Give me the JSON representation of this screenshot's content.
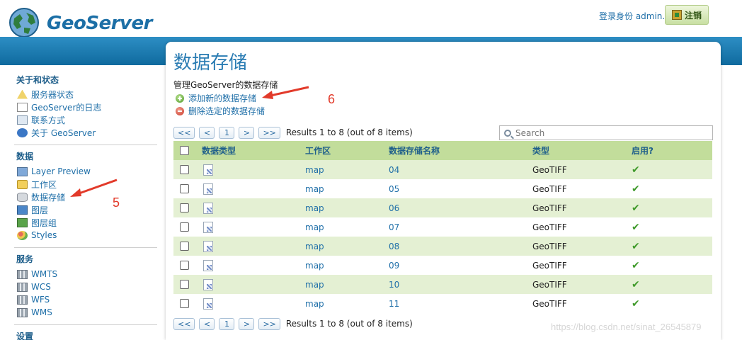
{
  "header": {
    "logo_text": "GeoServer",
    "login_info": "登录身份 admin.",
    "logout_label": "注销"
  },
  "sidebar": {
    "sections": [
      {
        "title": "关于和状态",
        "items": [
          {
            "label": "服务器状态",
            "icon": "warning-icon"
          },
          {
            "label": "GeoServer的日志",
            "icon": "document-icon"
          },
          {
            "label": "联系方式",
            "icon": "contact-card-icon"
          },
          {
            "label": "关于 GeoServer",
            "icon": "info-icon"
          }
        ]
      },
      {
        "title": "数据",
        "items": [
          {
            "label": "Layer Preview",
            "icon": "map-icon"
          },
          {
            "label": "工作区",
            "icon": "folder-icon"
          },
          {
            "label": "数据存储",
            "icon": "database-icon"
          },
          {
            "label": "图层",
            "icon": "layer-icon"
          },
          {
            "label": "图层组",
            "icon": "layer-group-icon"
          },
          {
            "label": "Styles",
            "icon": "styles-icon"
          }
        ]
      },
      {
        "title": "服务",
        "items": [
          {
            "label": "WMTS",
            "icon": "service-icon"
          },
          {
            "label": "WCS",
            "icon": "service-icon"
          },
          {
            "label": "WFS",
            "icon": "service-icon"
          },
          {
            "label": "WMS",
            "icon": "service-icon"
          }
        ]
      },
      {
        "title": "设置",
        "items": []
      }
    ]
  },
  "main": {
    "title": "数据存储",
    "description": "管理GeoServer的数据存储",
    "add_label": "添加新的数据存储",
    "remove_label": "删除选定的数据存储",
    "pager": {
      "first": "<<",
      "prev": "<",
      "page": "1",
      "next": ">",
      "last": ">>",
      "results": "Results 1 to 8 (out of 8 items)"
    },
    "search_placeholder": "Search",
    "table": {
      "headers": [
        "数据类型",
        "工作区",
        "数据存储名称",
        "类型",
        "启用?"
      ],
      "rows": [
        {
          "workspace": "map",
          "name": "04",
          "type": "GeoTIFF",
          "enabled": "✔"
        },
        {
          "workspace": "map",
          "name": "05",
          "type": "GeoTIFF",
          "enabled": "✔"
        },
        {
          "workspace": "map",
          "name": "06",
          "type": "GeoTIFF",
          "enabled": "✔"
        },
        {
          "workspace": "map",
          "name": "07",
          "type": "GeoTIFF",
          "enabled": "✔"
        },
        {
          "workspace": "map",
          "name": "08",
          "type": "GeoTIFF",
          "enabled": "✔"
        },
        {
          "workspace": "map",
          "name": "09",
          "type": "GeoTIFF",
          "enabled": "✔"
        },
        {
          "workspace": "map",
          "name": "10",
          "type": "GeoTIFF",
          "enabled": "✔"
        },
        {
          "workspace": "map",
          "name": "11",
          "type": "GeoTIFF",
          "enabled": "✔"
        }
      ]
    }
  },
  "annotations": {
    "label_5": "5",
    "label_6": "6",
    "arrow_color": "#e23a2a"
  },
  "watermark": "https://blog.csdn.net/sinat_26545879"
}
